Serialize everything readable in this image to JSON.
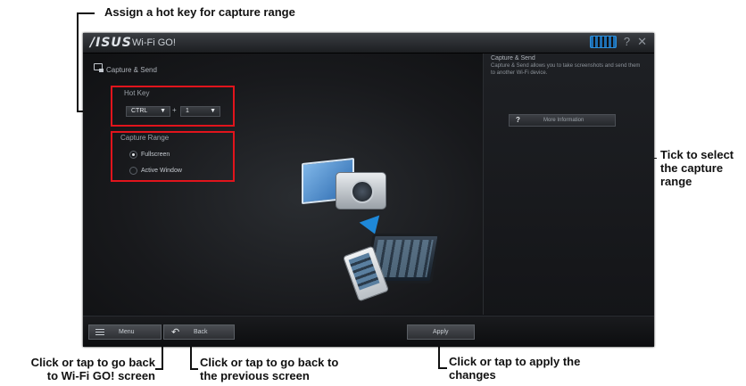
{
  "callouts": {
    "hotkey": "Assign a hot key for capture range",
    "tick": [
      "Tick to select",
      "the capture",
      "range"
    ],
    "menu": [
      "Click or tap to go back",
      "to Wi-Fi GO! screen"
    ],
    "back": [
      "Click or tap to go back to",
      "the previous screen"
    ],
    "apply": [
      "Click or tap to apply the",
      "changes"
    ]
  },
  "app": {
    "logo": "/ISUS",
    "title": "Wi-Fi GO!",
    "section_title": "Capture & Send",
    "hotkey": {
      "label": "Hot Key",
      "modifier": "CTRL",
      "plus": "+",
      "key": "1"
    },
    "capture_range": {
      "label": "Capture Range",
      "options": [
        {
          "label": "Fullscreen",
          "selected": true
        },
        {
          "label": "Active Window",
          "selected": false
        }
      ]
    },
    "right_panel": {
      "title": "Capture & Send",
      "description": "Capture & Send allows you to take screenshots and send them to another Wi-Fi device.",
      "more_info_icon": "?",
      "more_info": "More Information"
    },
    "bottom": {
      "menu": "Menu",
      "back": "Back",
      "apply": "Apply"
    },
    "window_controls": {
      "help": "?",
      "close": "✕"
    }
  },
  "colors": {
    "callout_box": "#e1141c",
    "accent": "#1e88d8"
  }
}
